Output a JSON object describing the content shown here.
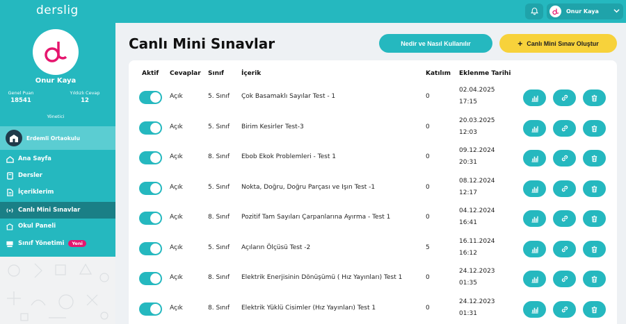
{
  "app": {
    "logo": "derslig"
  },
  "topbar": {
    "user_name": "Onur Kaya"
  },
  "profile": {
    "name": "Onur Kaya",
    "genel_puan_label": "Genel Puan",
    "genel_puan_value": "18541",
    "yildizli_label": "Yıldızlı Cevap",
    "yildizli_value": "12",
    "role": "Yönetici",
    "school": "Erdemli Ortaokulu"
  },
  "nav": [
    {
      "label": "Ana Sayfa",
      "icon": "home-icon"
    },
    {
      "label": "Dersler",
      "icon": "book-icon"
    },
    {
      "label": "İçeriklerim",
      "icon": "document-icon"
    },
    {
      "label": "Canlı Mini Sınavlar",
      "icon": "broadcast-icon",
      "active": true
    },
    {
      "label": "Okul Paneli",
      "icon": "school-icon"
    },
    {
      "label": "Sınıf Yönetimi",
      "icon": "class-icon",
      "badge": "Yeni"
    }
  ],
  "page": {
    "title": "Canlı Mini Sınavlar",
    "how_button": "Nedir ve Nasıl Kullanılır",
    "create_button": "Canlı Mini Sınav Oluştur"
  },
  "table": {
    "headers": {
      "aktif": "Aktif",
      "cevaplar": "Cevaplar",
      "sinif": "Sınıf",
      "icerik": "İçerik",
      "katilim": "Katılım",
      "tarih": "Eklenme Tarihi"
    },
    "rows": [
      {
        "cevaplar": "Açık",
        "sinif": "5. Sınıf",
        "icerik": "Çok Basamaklı Sayılar Test - 1",
        "katilim": "0",
        "date": "02.04.2025",
        "time": "17:15"
      },
      {
        "cevaplar": "Açık",
        "sinif": "5. Sınıf",
        "icerik": "Birim Kesirler Test-3",
        "katilim": "0",
        "date": "20.03.2025",
        "time": "12:03"
      },
      {
        "cevaplar": "Açık",
        "sinif": "8. Sınıf",
        "icerik": "Ebob Ekok Problemleri - Test 1",
        "katilim": "0",
        "date": "09.12.2024",
        "time": "20:31"
      },
      {
        "cevaplar": "Açık",
        "sinif": "5. Sınıf",
        "icerik": "Nokta, Doğru, Doğru Parçası ve Işın Test -1",
        "katilim": "0",
        "date": "08.12.2024",
        "time": "12:17"
      },
      {
        "cevaplar": "Açık",
        "sinif": "8. Sınıf",
        "icerik": "Pozitif Tam Sayıları Çarpanlarına Ayırma - Test 1",
        "katilim": "0",
        "date": "04.12.2024",
        "time": "16:41"
      },
      {
        "cevaplar": "Açık",
        "sinif": "5. Sınıf",
        "icerik": "Açıların Ölçüsü Test -2",
        "katilim": "5",
        "date": "16.11.2024",
        "time": "16:12"
      },
      {
        "cevaplar": "Açık",
        "sinif": "8. Sınıf",
        "icerik": "Elektrik Enerjisinin Dönüşümü ( Hız Yayınları) Test 1",
        "katilim": "0",
        "date": "24.12.2023",
        "time": "01:35"
      },
      {
        "cevaplar": "Açık",
        "sinif": "8. Sınıf",
        "icerik": "Elektrik Yüklü Cisimler (Hız Yayınları) Test 1",
        "katilim": "0",
        "date": "24.12.2023",
        "time": "01:31"
      }
    ]
  },
  "colors": {
    "primary": "#25b8bf",
    "accent": "#f7d23b",
    "badge": "#e5166e",
    "active_nav": "#1a7f86"
  }
}
